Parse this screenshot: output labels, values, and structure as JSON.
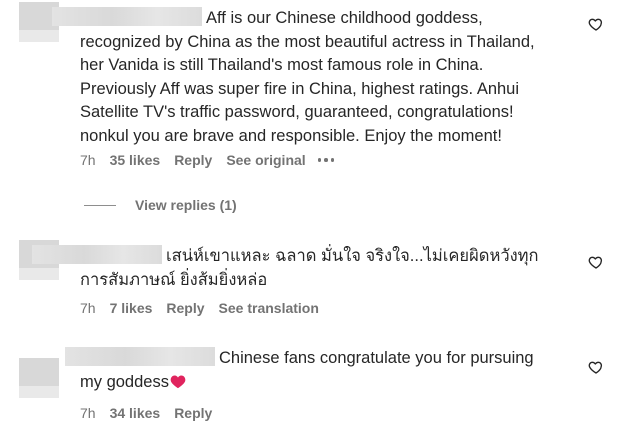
{
  "comments": [
    {
      "text": "Aff is our Chinese childhood goddess, recognized by China as the most beautiful actress in Thailand, her Vanida is still Thailand's most famous role in China. Previously Aff was super fire in China, highest ratings. Anhui Satellite TV's traffic password, guaranteed, congratulations! nonkul you are brave and responsible. Enjoy the moment!",
      "time": "7h",
      "likes": "35 likes",
      "reply": "Reply",
      "extra": "See original"
    },
    {
      "text": "เสน่ห์เขาแหละ ฉลาด มั่นใจ จริงใจ...ไม่เคยผิดหวังทุกการสัมภาษณ์ ยิ่งส้มยิ่งหล่อ",
      "time": "7h",
      "likes": "7 likes",
      "reply": "Reply",
      "extra": "See translation"
    },
    {
      "text": "Chinese fans congratulate you for pursuing my goddess",
      "time": "7h",
      "likes": "34 likes",
      "reply": "Reply"
    }
  ],
  "view_replies": "View replies (1)",
  "colors": {
    "text": "#262626",
    "meta": "#737373",
    "heart_emoji": "#e0245e"
  }
}
